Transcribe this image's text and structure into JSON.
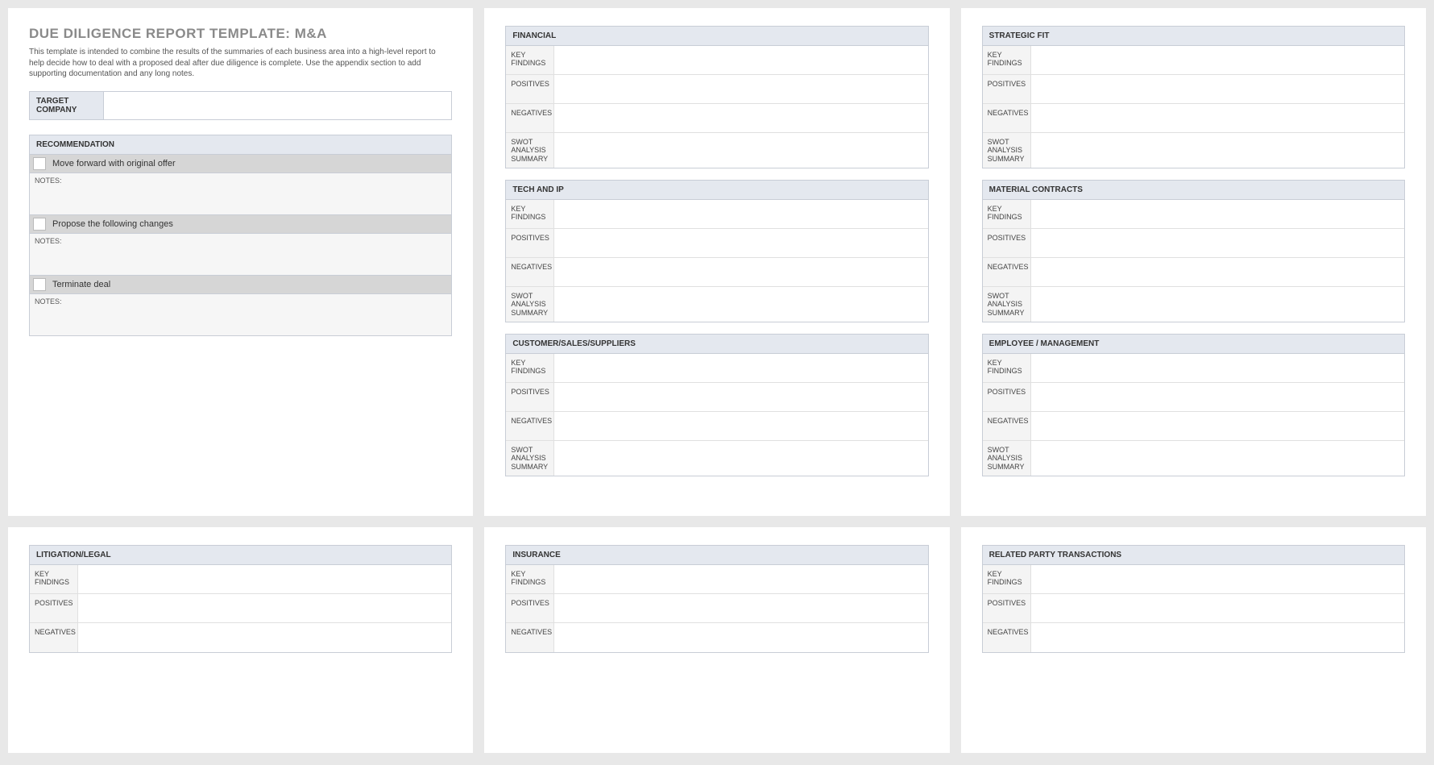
{
  "title": "DUE DILIGENCE REPORT TEMPLATE: M&A",
  "intro": "This template is intended to combine the results of the summaries of each business area into a high-level report to help decide how to deal with a proposed deal after due diligence is complete.  Use the appendix section to add supporting documentation and any long notes.",
  "target_company_label": "TARGET COMPANY",
  "recommendation_header": "RECOMMENDATION",
  "notes_label": "NOTES:",
  "rec_options": [
    "Move forward with original offer",
    "Propose the following changes",
    "Terminate deal"
  ],
  "row_labels": {
    "key_findings": "KEY FINDINGS",
    "positives": "POSITIVES",
    "negatives": "NEGATIVES",
    "swot": "SWOT ANALYSIS SUMMARY"
  },
  "sections_col2_a": [
    "FINANCIAL",
    "TECH AND IP",
    "CUSTOMER/SALES/SUPPLIERS"
  ],
  "sections_col3_a": [
    "STRATEGIC FIT",
    "MATERIAL CONTRACTS",
    "EMPLOYEE / MANAGEMENT"
  ],
  "sections_row2": [
    "LITIGATION/LEGAL",
    "INSURANCE",
    "RELATED PARTY TRANSACTIONS"
  ]
}
